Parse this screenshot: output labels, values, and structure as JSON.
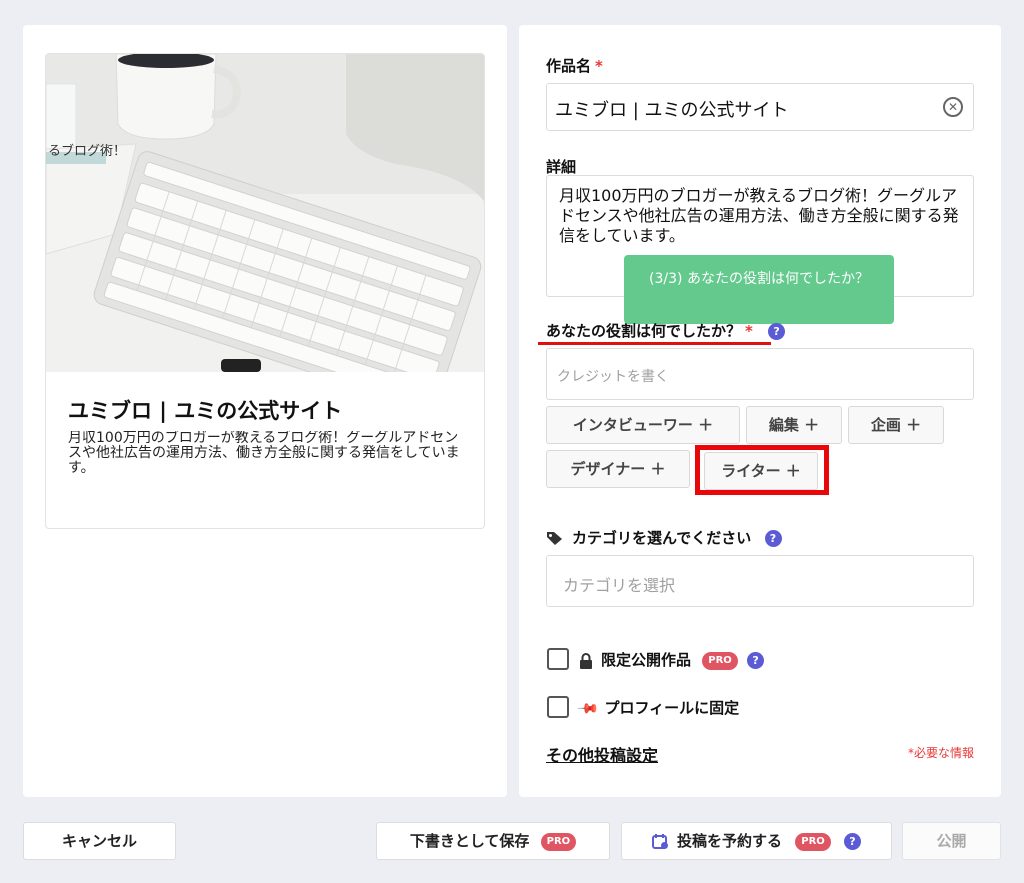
{
  "preview": {
    "image_overlay_text": "るブログ術！",
    "title": "ユミブロ | ユミの公式サイト",
    "description": "月収100万円のブロガーが教えるブログ術！グーグルアドセンスや他社広告の運用方法、働き方全般に関する発信をしています。"
  },
  "form": {
    "title_label": "作品名",
    "required_mark": "*",
    "title_value": "ユミブロ | ユミの公式サイト",
    "detail_label": "詳細",
    "detail_value": "月収100万円のブロガーが教えるブログ術！グーグルアドセンスや他社広告の運用方法、働き方全般に関する発信をしています。",
    "tooltip": "(3/3) あなたの役割は何でしたか？",
    "role_label": "あなたの役割は何でしたか？",
    "help": "?",
    "credit_placeholder": "クレジットを書く",
    "roles": [
      "インタビューワー ＋",
      "編集 ＋",
      "企画 ＋",
      "デザイナー ＋",
      "ライター ＋"
    ],
    "category_label": "カテゴリを選んでください",
    "category_placeholder": "カテゴリを選択",
    "limited_label": "限定公開作品",
    "pro_badge": "PRO",
    "pin_label": "プロフィールに固定",
    "other_settings": "その他投稿設定",
    "required_note": "*必要な情報"
  },
  "footer": {
    "cancel": "キャンセル",
    "save_draft": "下書きとして保存",
    "schedule": "投稿を予約する",
    "publish": "公開"
  },
  "colors": {
    "accent_purple": "#5b5bd6",
    "pro_badge": "#e05562",
    "tooltip_green": "#63c98d",
    "highlight_red": "#e8080b"
  }
}
